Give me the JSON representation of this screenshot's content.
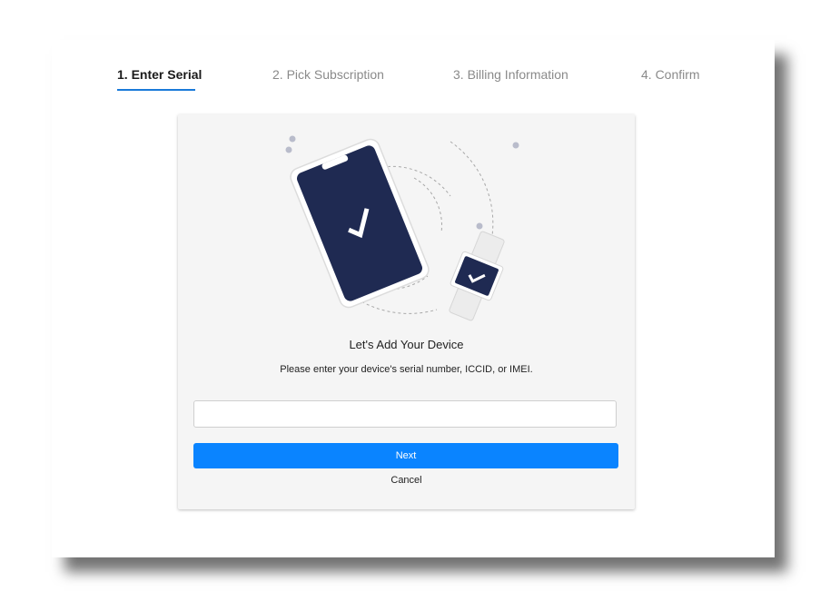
{
  "steps": [
    {
      "label": "1. Enter Serial",
      "active": true
    },
    {
      "label": "2. Pick Subscription",
      "active": false
    },
    {
      "label": "3. Billing Information",
      "active": false
    },
    {
      "label": "4. Confirm",
      "active": false
    }
  ],
  "card": {
    "illustration": "phone-and-smartwatch-checkmark",
    "title": "Let's Add Your Device",
    "subtitle": "Please enter your device's serial number, ICCID, or IMEI.",
    "input_value": "",
    "next_label": "Next",
    "cancel_label": "Cancel"
  },
  "colors": {
    "accent": "#0a84ff",
    "step_underline": "#1a7ad9",
    "device_screen": "#1f2a52"
  }
}
